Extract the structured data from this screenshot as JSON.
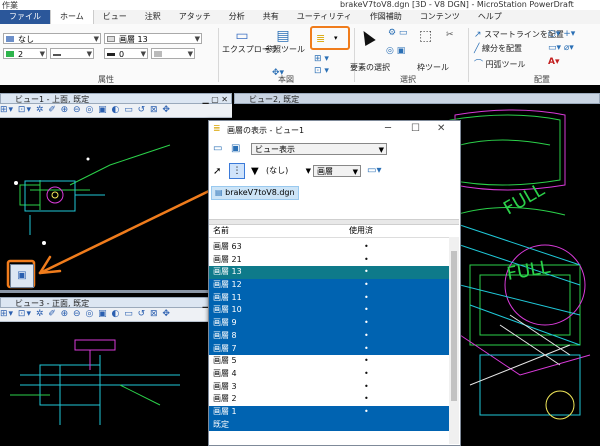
{
  "window": {
    "title": "brakeV7toV8.dgn [3D - V8 DGN] - MicroStation PowerDraft",
    "qa_label": "作業"
  },
  "menu": {
    "items": [
      "ファイル",
      "ホーム",
      "ビュー",
      "注釈",
      "アタッチ",
      "分析",
      "共有",
      "ユーティリティ",
      "作図補助",
      "コンテンツ",
      "ヘルプ"
    ]
  },
  "ribbon": {
    "level_value": "なし",
    "layer_value": "画層 13",
    "color_value": "2",
    "weight_value": "0",
    "group_attributes": "属性",
    "explorer_label": "エクスプローラ",
    "reference_label": "参照ツール",
    "group_main": "本図",
    "select_label": "要素の選択",
    "group_selection": "選択",
    "fence_label": "枠ツール",
    "smartline_label": "スマートラインを配置",
    "line_label": "線分を配置",
    "arc_label": "円弧ツール",
    "group_place": "配置"
  },
  "views": {
    "view1_title": "ビュー1 - 上面, 既定",
    "view2_title": "ビュー2, 既定",
    "view3_title": "ビュー3 - 正面, 既定"
  },
  "dialog": {
    "title": "画層の表示 - ビュー1",
    "view_combo": "ビュー表示",
    "filter_combo": "(なし)",
    "layer_combo": "画層",
    "file_name": "brakeV7toV8.dgn",
    "col_name": "名前",
    "col_used": "使用済",
    "rows": [
      {
        "name": "画層 63",
        "used": "•",
        "state": "none"
      },
      {
        "name": "画層 21",
        "used": "•",
        "state": "none"
      },
      {
        "name": "画層 13",
        "used": "•",
        "state": "highlight"
      },
      {
        "name": "画層 12",
        "used": "•",
        "state": "selected"
      },
      {
        "name": "画層 11",
        "used": "•",
        "state": "selected"
      },
      {
        "name": "画層 10",
        "used": "•",
        "state": "selected"
      },
      {
        "name": "画層 9",
        "used": "•",
        "state": "selected"
      },
      {
        "name": "画層 8",
        "used": "•",
        "state": "selected"
      },
      {
        "name": "画層 7",
        "used": "•",
        "state": "selected"
      },
      {
        "name": "画層 5",
        "used": "•",
        "state": "none"
      },
      {
        "name": "画層 4",
        "used": "•",
        "state": "none"
      },
      {
        "name": "画層 3",
        "used": "•",
        "state": "none"
      },
      {
        "name": "画層 2",
        "used": "•",
        "state": "none"
      },
      {
        "name": "画層 1",
        "used": "•",
        "state": "selected"
      },
      {
        "name": "既定",
        "used": "",
        "state": "selected"
      }
    ]
  },
  "colors": {
    "selected": "#0063b1",
    "highlight": "#0e7a8a",
    "annotation": "#f07c1c"
  }
}
